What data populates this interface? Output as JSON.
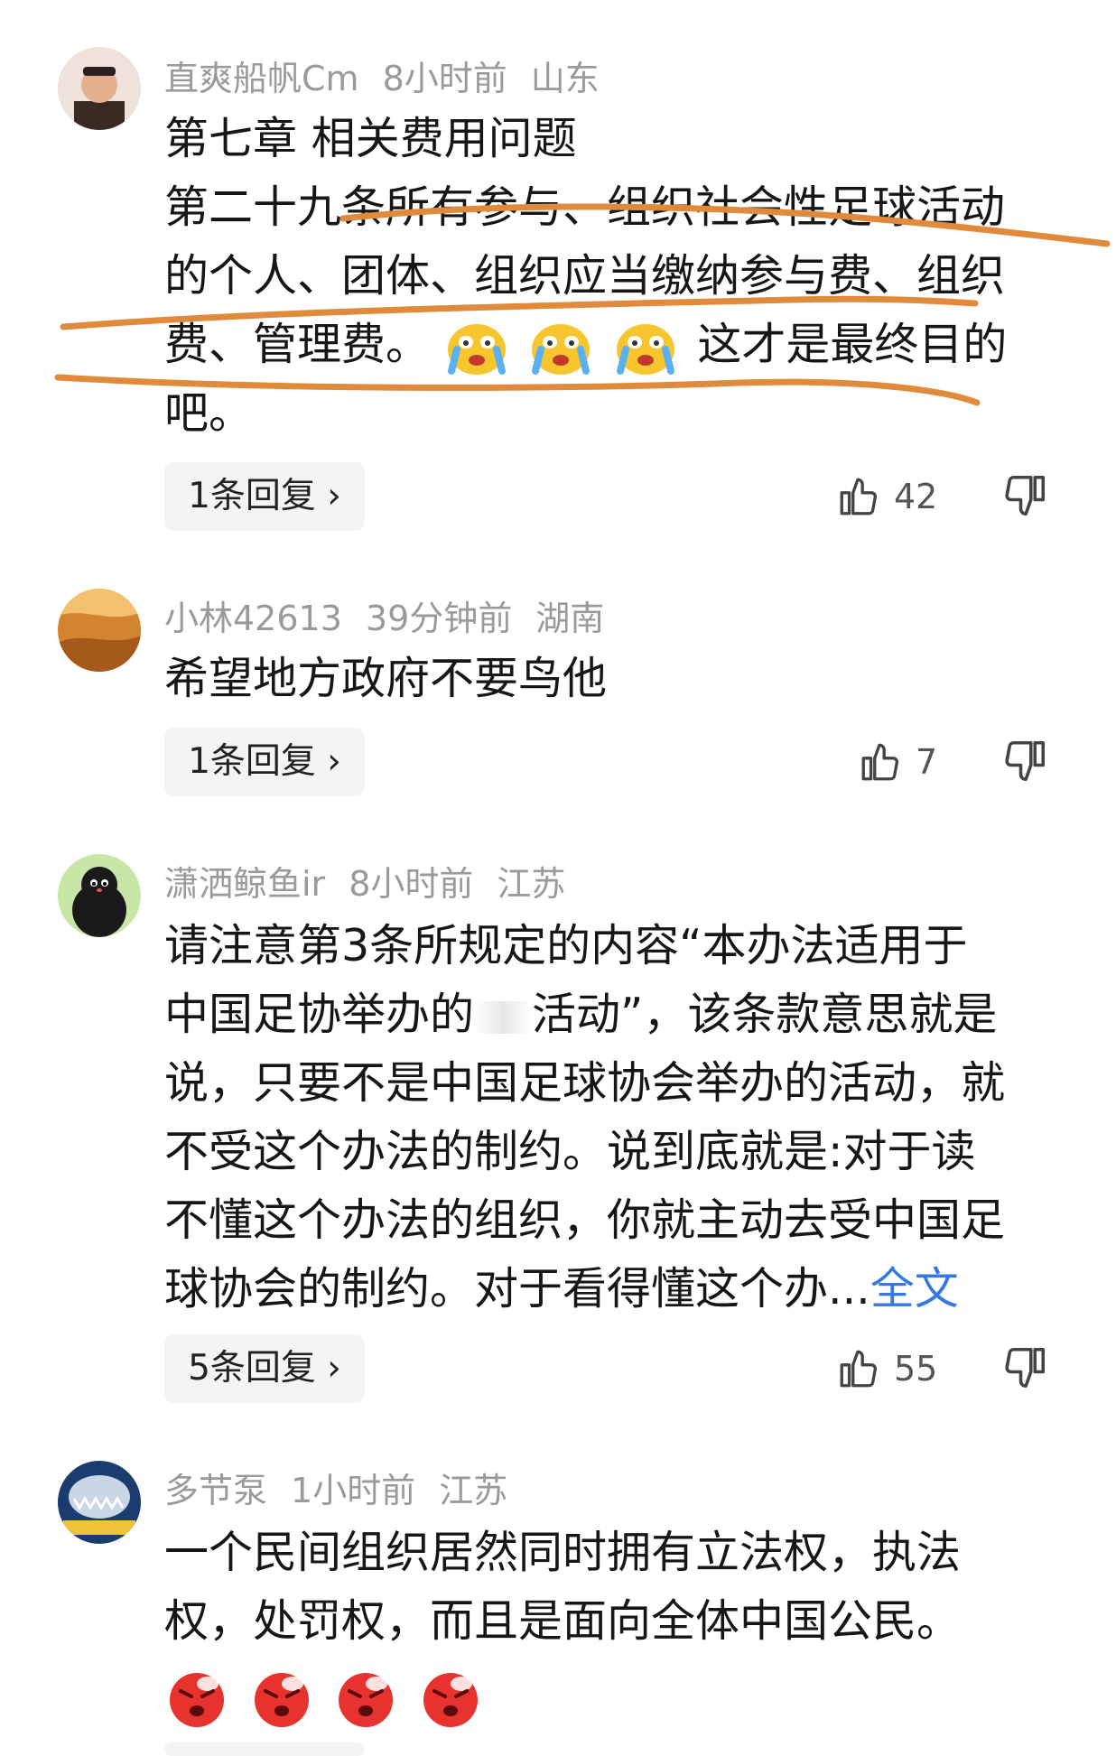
{
  "comments": [
    {
      "username": "直爽船帆Cm",
      "time": "8小时前",
      "location": "山东",
      "lines": [
        "第七章 相关费用问题",
        "第二十九条所有参与、组织社会性足球活动",
        "的个人、团体、组织应当缴纳参与费、组织",
        "费、管理费。",
        "这才是最终目的",
        "吧。"
      ],
      "emoji": "crying-emoji",
      "reply_label": "1条回复 ›",
      "likes": "42"
    },
    {
      "username": "小林42613",
      "time": "39分钟前",
      "location": "湖南",
      "lines": [
        "希望地方政府不要鸟他"
      ],
      "reply_label": "1条回复 ›",
      "likes": "7"
    },
    {
      "username": "潇洒鲸鱼ir",
      "time": "8小时前",
      "location": "江苏",
      "lines": [
        "请注意第3条所规定的内容“本办法适用于",
        "中国足协举办的",
        "活动”，该条款意思就是",
        "说，只要不是中国足球协会举办的活动，就",
        "不受这个办法的制约。说到底就是:对于读",
        "不懂这个办法的组织，你就主动去受中国足",
        "球协会的制约。对于看得懂这个办..."
      ],
      "fulltext_label": "全文",
      "reply_label": "5条回复 ›",
      "likes": "55"
    },
    {
      "username": "多节泵",
      "time": "1小时前",
      "location": "江苏",
      "lines": [
        "一个民间组织居然同时拥有立法权，执法",
        "权，处罚权，而且是面向全体中国公民。"
      ],
      "emoji": "angry-emoji"
    }
  ],
  "colors": {
    "meta": "#9a9a9a",
    "link": "#3478e6",
    "annotation": "#e08a3c",
    "reply_bg": "#f4f4f4"
  }
}
